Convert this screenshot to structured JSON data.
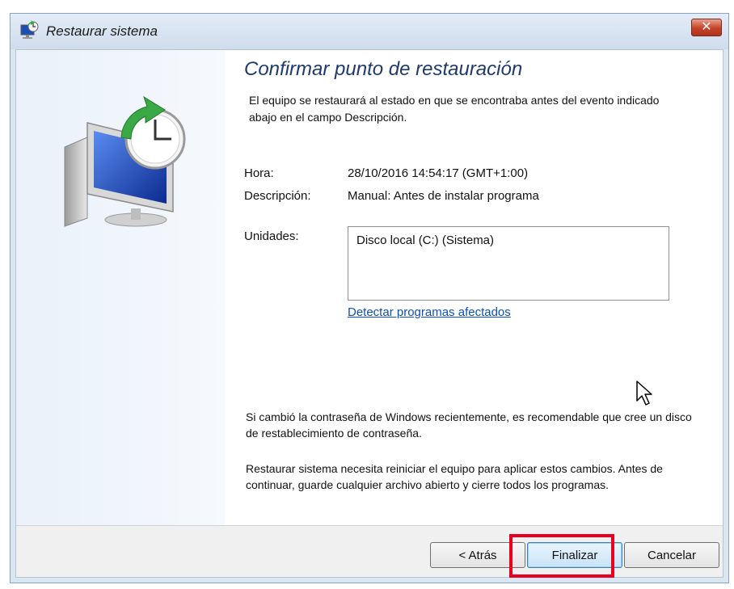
{
  "window": {
    "title": "Restaurar sistema",
    "close_label": "✕"
  },
  "main": {
    "heading": "Confirmar punto de restauración",
    "intro": "El equipo se restaurará al estado en que se encontraba antes del evento indicado abajo en el campo Descripción.",
    "time_label": "Hora:",
    "time_value": "28/10/2016 14:54:17 (GMT+1:00)",
    "description_label": "Descripción:",
    "description_value": "Manual: Antes de instalar programa",
    "drives_label": "Unidades:",
    "drives": [
      "Disco local (C:) (Sistema)"
    ],
    "detect_link": "Detectar programas afectados",
    "password_note": "Si cambió la contraseña de Windows recientemente, es recomendable que cree un disco de restablecimiento de contraseña.",
    "restart_note": "Restaurar sistema necesita reiniciar el equipo para aplicar estos cambios. Antes de continuar, guarde cualquier archivo abierto y cierre todos los programas."
  },
  "footer": {
    "back_label": "< Atrás",
    "finish_label": "Finalizar",
    "cancel_label": "Cancelar"
  },
  "colors": {
    "heading": "#1e3a6e",
    "link": "#0b4fbf",
    "highlight": "#e8001e",
    "close_button": "#c4422a"
  },
  "icons": {
    "title_icon": "system-restore-icon",
    "hero_icon": "restore-monitor-clock-icon",
    "cursor": "mouse-pointer-icon"
  }
}
